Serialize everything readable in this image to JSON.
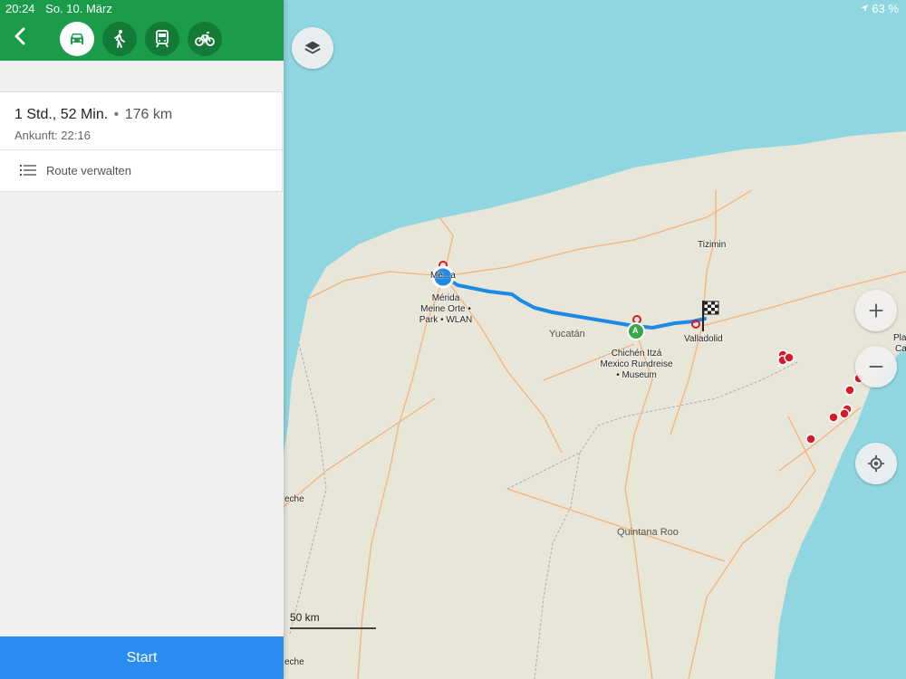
{
  "status_bar": {
    "time": "20:24",
    "date": "So. 10. März",
    "battery": "63 %"
  },
  "header": {
    "modes": [
      {
        "name": "car",
        "active": true
      },
      {
        "name": "walk",
        "active": false
      },
      {
        "name": "train",
        "active": false
      },
      {
        "name": "bike",
        "active": false
      }
    ]
  },
  "route_card": {
    "duration": "1 Std., 52 Min.",
    "separator": "•",
    "distance": "176 km",
    "arrival": "Ankunft: 22:16",
    "manage_label": "Route verwalten"
  },
  "start_button": {
    "label": "Start"
  },
  "map": {
    "labels": {
      "tizimin": "Tizimin",
      "merida_short": "Mé...a",
      "merida": "Mérida",
      "merida_sub1": "Meine Orte •",
      "merida_sub2": "Park • WLAN",
      "yucatan": "Yucatán",
      "chichen": "Chichén Itzá",
      "chichen_sub1": "Mexico Rundreise",
      "chichen_sub2": "• Museum",
      "valladolid": "Valladolid",
      "quintana_roo": "Quintana Roo",
      "playa1": "Play",
      "playa2": "Ca",
      "campeche1": "eche",
      "campeche2": "eche",
      "waypoint_a": "A"
    },
    "scale": "50 km",
    "colors": {
      "water": "#90d6e1",
      "land": "#e8e6d9",
      "route": "#1e88e5",
      "road": "#f3b27a",
      "pin": "#d9192a"
    }
  }
}
